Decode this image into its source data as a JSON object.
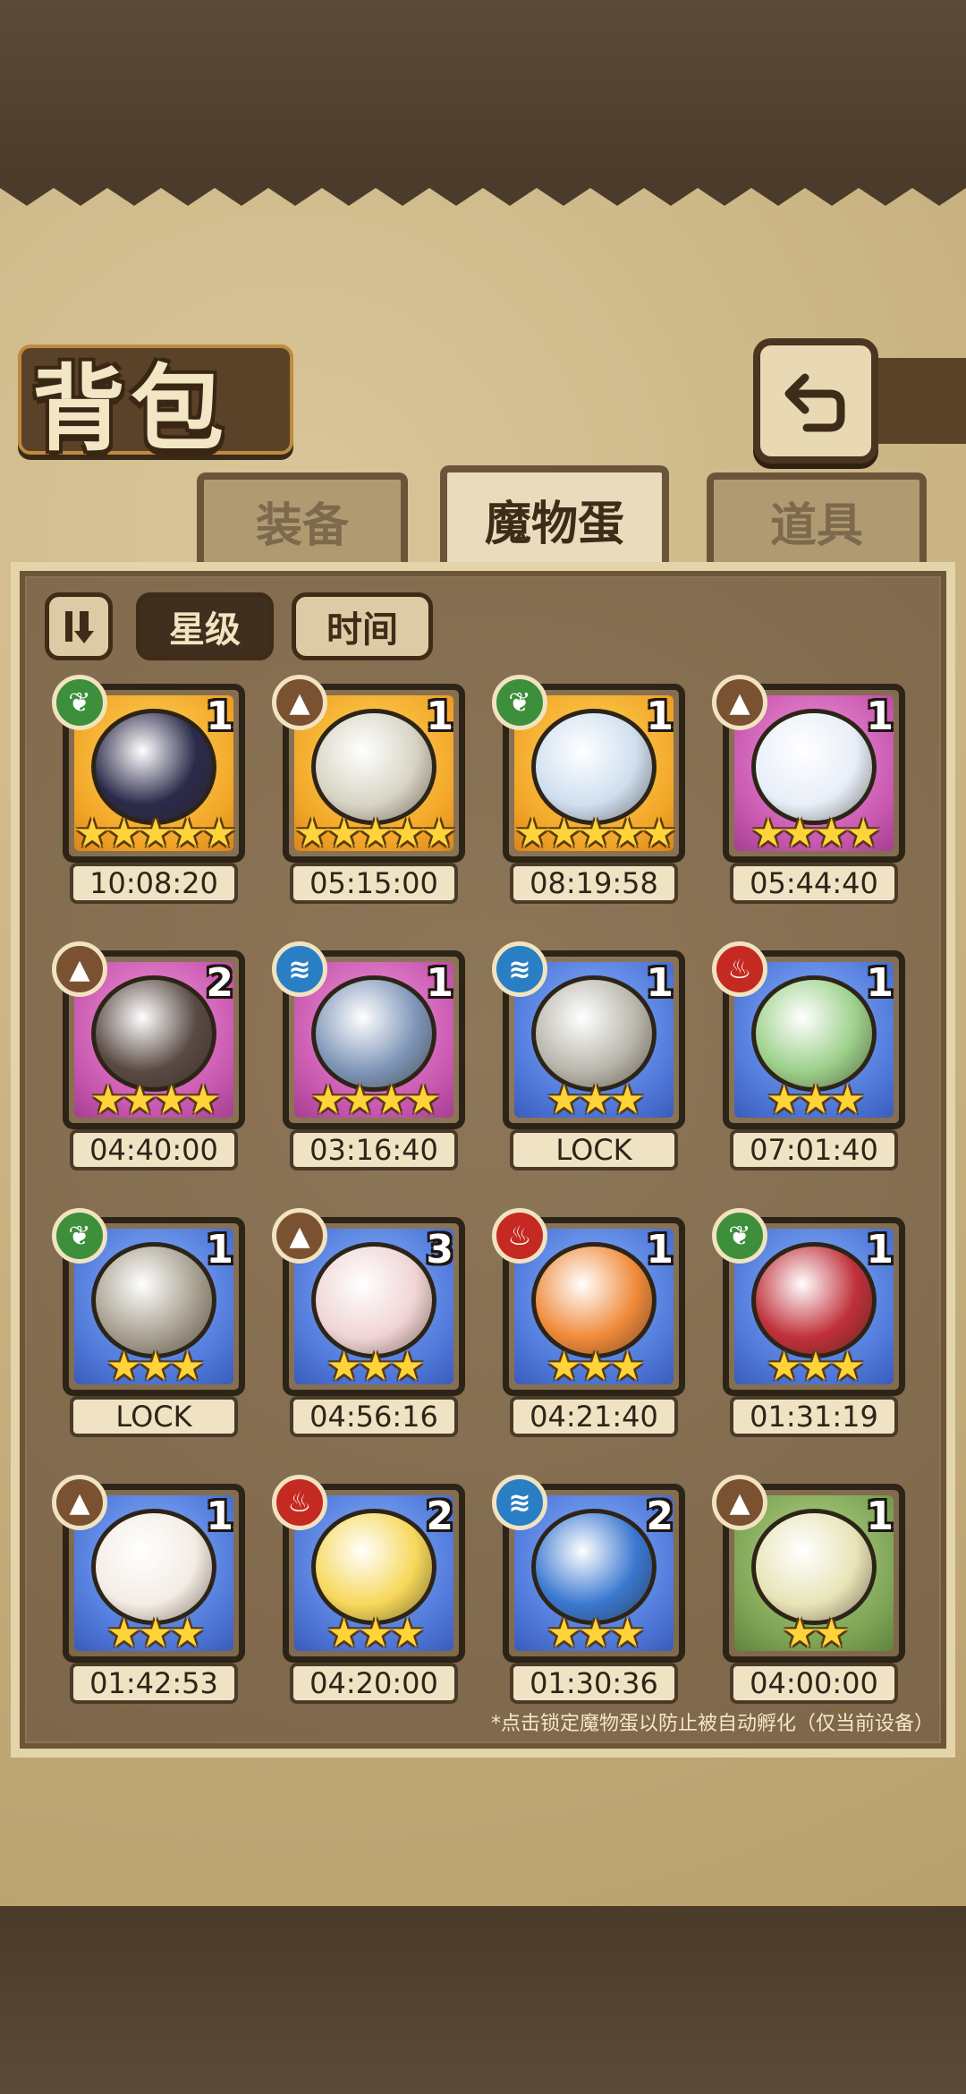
{
  "header": {
    "title": "背包",
    "back_icon": "back-arrow-icon"
  },
  "tabs": [
    {
      "label": "装备",
      "active": false
    },
    {
      "label": "魔物蛋",
      "active": true
    },
    {
      "label": "道具",
      "active": false
    }
  ],
  "sort": {
    "toggle_icon": "sort-order-icon",
    "star_label": "星级",
    "time_label": "时间",
    "selected": "星级"
  },
  "eggs": [
    {
      "element": "leaf",
      "qty": "1",
      "stars": "★★★★★",
      "timer": "10:08:20",
      "rarity": "legend",
      "art_color": "#2b2a4a"
    },
    {
      "element": "earth",
      "qty": "1",
      "stars": "★★★★★",
      "timer": "05:15:00",
      "rarity": "legend",
      "art_color": "#d8d4c4"
    },
    {
      "element": "leaf",
      "qty": "1",
      "stars": "★★★★★",
      "timer": "08:19:58",
      "rarity": "legend",
      "art_color": "#cfdff0"
    },
    {
      "element": "earth",
      "qty": "1",
      "stars": "★★★★",
      "timer": "05:44:40",
      "rarity": "epic",
      "art_color": "#e8eef8"
    },
    {
      "element": "earth",
      "qty": "2",
      "stars": "★★★★",
      "timer": "04:40:00",
      "rarity": "epic",
      "art_color": "#5a4a44"
    },
    {
      "element": "water",
      "qty": "1",
      "stars": "★★★★",
      "timer": "03:16:40",
      "rarity": "epic",
      "art_color": "#7f96b8"
    },
    {
      "element": "water",
      "qty": "1",
      "stars": "★★★",
      "timer": "LOCK",
      "rarity": "rare",
      "art_color": "#b9b6ac"
    },
    {
      "element": "fire",
      "qty": "1",
      "stars": "★★★",
      "timer": "07:01:40",
      "rarity": "rare",
      "art_color": "#9cd08a"
    },
    {
      "element": "leaf",
      "qty": "1",
      "stars": "★★★",
      "timer": "LOCK",
      "rarity": "rare",
      "art_color": "#a8a090"
    },
    {
      "element": "earth",
      "qty": "3",
      "stars": "★★★",
      "timer": "04:56:16",
      "rarity": "rare",
      "art_color": "#f0d4d4"
    },
    {
      "element": "fire",
      "qty": "1",
      "stars": "★★★",
      "timer": "04:21:40",
      "rarity": "rare",
      "art_color": "#f08a3a"
    },
    {
      "element": "leaf",
      "qty": "1",
      "stars": "★★★",
      "timer": "01:31:19",
      "rarity": "rare",
      "art_color": "#c0303a"
    },
    {
      "element": "earth",
      "qty": "1",
      "stars": "★★★",
      "timer": "01:42:53",
      "rarity": "rare",
      "art_color": "#f4ece4"
    },
    {
      "element": "fire",
      "qty": "2",
      "stars": "★★★",
      "timer": "04:20:00",
      "rarity": "rare",
      "art_color": "#f6d85a"
    },
    {
      "element": "water",
      "qty": "2",
      "stars": "★★★",
      "timer": "01:30:36",
      "rarity": "rare",
      "art_color": "#3a78d0"
    },
    {
      "element": "earth",
      "qty": "1",
      "stars": "★★",
      "timer": "04:00:00",
      "rarity": "uncommon",
      "art_color": "#e8e4b8"
    }
  ],
  "footer_note": "*点击锁定魔物蛋以防止被自动孵化（仅当前设备）"
}
